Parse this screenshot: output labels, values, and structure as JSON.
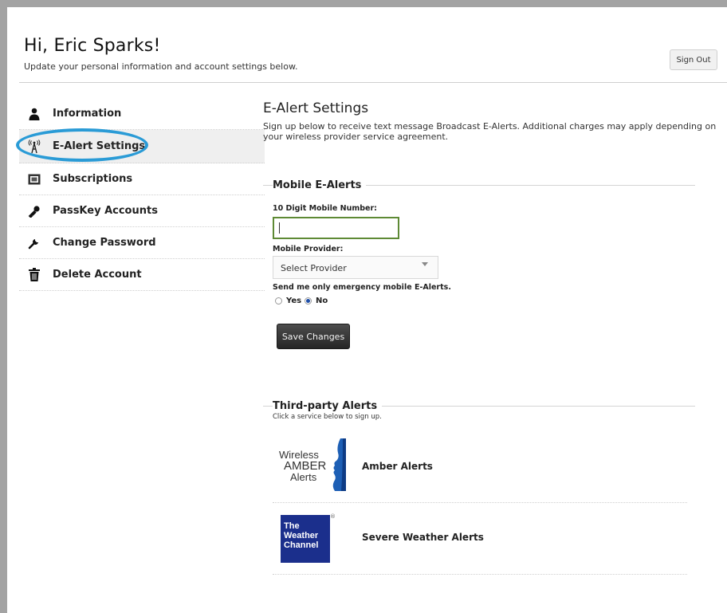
{
  "header": {
    "greeting": "Hi, Eric Sparks!",
    "subtitle": "Update your personal information and account settings below.",
    "sign_out_label": "Sign Out"
  },
  "sidebar": {
    "active": "E-Alert Settings",
    "items": [
      {
        "label": "Information",
        "icon": "person-icon"
      },
      {
        "label": "E-Alert Settings",
        "icon": "antenna-icon"
      },
      {
        "label": "Subscriptions",
        "icon": "newspaper-icon"
      },
      {
        "label": "PassKey Accounts",
        "icon": "key-icon"
      },
      {
        "label": "Change Password",
        "icon": "wrench-icon"
      },
      {
        "label": "Delete Account",
        "icon": "trash-icon"
      }
    ]
  },
  "main": {
    "title": "E-Alert Settings",
    "description": "Sign up below to receive text message Broadcast E-Alerts. Additional charges may apply depending on your wireless provider service agreement.",
    "mobile_section": {
      "legend": "Mobile E-Alerts",
      "phone_label": "10 Digit Mobile Number:",
      "phone_value": "",
      "provider_label": "Mobile Provider:",
      "provider_selected": "Select Provider",
      "emergency_label": "Send me only emergency mobile E-Alerts.",
      "radio_yes": "Yes",
      "radio_no": "No",
      "selected": "No",
      "save_label": "Save Changes"
    },
    "third_party": {
      "legend": "Third-party Alerts",
      "subtitle": "Click a service below to sign up.",
      "services": [
        {
          "name": "Amber Alerts",
          "logo_lines": [
            "Wireless",
            "AMBER",
            "Alerts"
          ]
        },
        {
          "name": "Severe Weather Alerts",
          "logo_lines": [
            "The",
            "Weather",
            "Channel"
          ],
          "logo_mark": "®"
        }
      ]
    }
  },
  "colors": {
    "highlight": "#2a9bd6",
    "input_focus": "#5e8a35",
    "weather_blue": "#1b2f8c"
  }
}
